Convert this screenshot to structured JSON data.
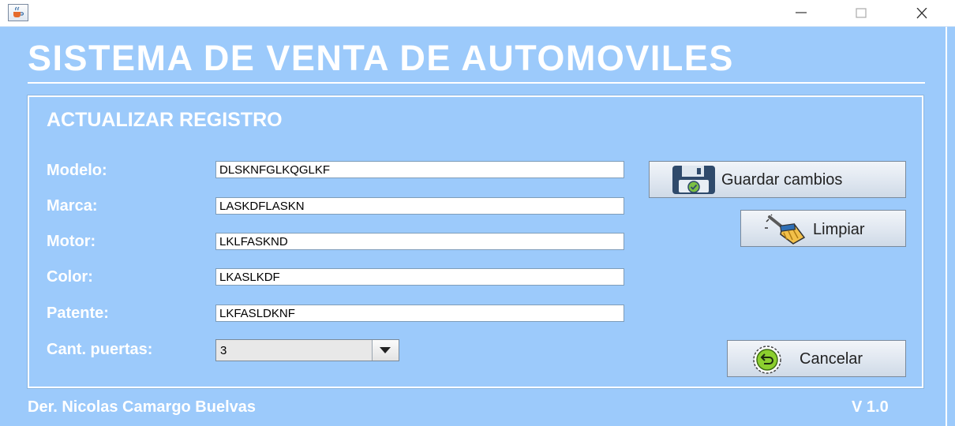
{
  "app": {
    "title": "SISTEMA DE VENTA DE AUTOMOVILES",
    "section_title": "ACTUALIZAR REGISTRO",
    "author": "Der. Nicolas Camargo Buelvas",
    "version": "V 1.0"
  },
  "window": {
    "icon": "java-cup-icon",
    "controls": [
      "minimize-icon",
      "maximize-icon",
      "close-icon"
    ]
  },
  "form": {
    "modelo": {
      "label": "Modelo:",
      "value": "DLSKNFGLKQGLKF"
    },
    "marca": {
      "label": "Marca:",
      "value": "LASKDFLASKN"
    },
    "motor": {
      "label": "Motor:",
      "value": "LKLFASKND"
    },
    "color": {
      "label": "Color:",
      "value": "LKASLKDF"
    },
    "patente": {
      "label": "Patente:",
      "value": "LKFASLDKNF"
    },
    "puertas": {
      "label": "Cant. puertas:",
      "selected": "3"
    }
  },
  "buttons": {
    "save": {
      "label": "Guardar cambios",
      "icon": "floppy-disk-icon"
    },
    "clear": {
      "label": "Limpiar",
      "icon": "broom-icon"
    },
    "cancel": {
      "label": "Cancelar",
      "icon": "undo-circle-icon"
    }
  },
  "colors": {
    "background": "#9ccafb",
    "text_light": "#ffffff"
  }
}
